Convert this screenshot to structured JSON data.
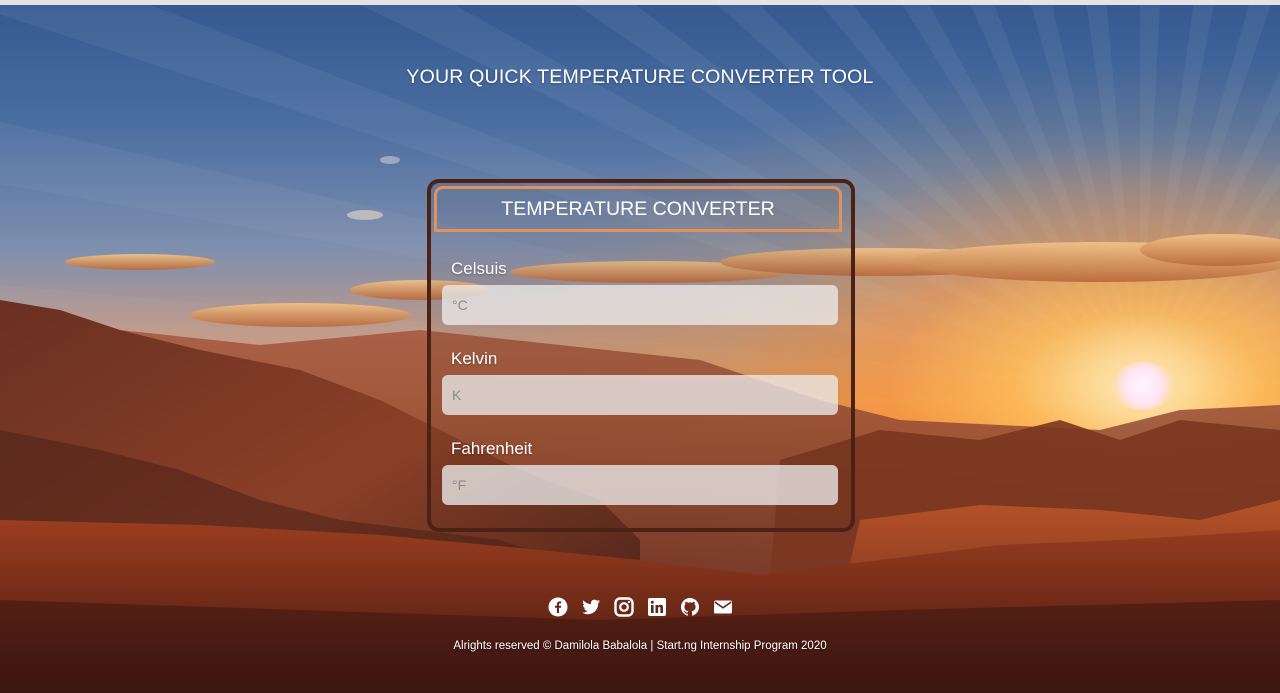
{
  "page": {
    "heading": "YOUR QUICK TEMPERATURE CONVERTER TOOL"
  },
  "converter": {
    "title": "TEMPERATURE CONVERTER",
    "fields": [
      {
        "label": "Celsuis",
        "placeholder": "°C",
        "value": ""
      },
      {
        "label": "Kelvin",
        "placeholder": "K",
        "value": ""
      },
      {
        "label": "Fahrenheit",
        "placeholder": "°F",
        "value": ""
      }
    ],
    "colors": {
      "card_border": "#4a2316",
      "header_border": "#e2915a"
    }
  },
  "footer": {
    "social_icons": [
      "facebook-icon",
      "twitter-icon",
      "instagram-icon",
      "linkedin-icon",
      "github-icon",
      "envelope-icon"
    ],
    "copyright": "Alrights reserved © Damilola Babalola | Start.ng Internship Program 2020"
  }
}
